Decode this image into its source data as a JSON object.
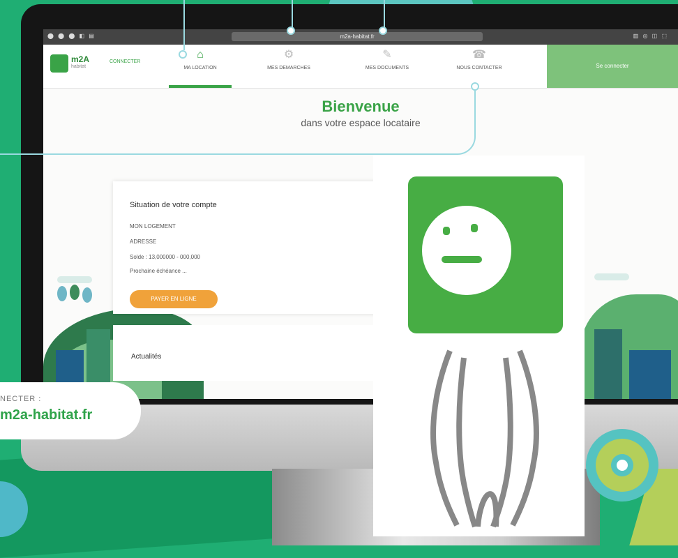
{
  "menubar": {
    "left": "⬤ ⬤ ⬤  ◧  ▤",
    "url": "m2a-habitat.fr",
    "right": "▥ ◎ ◫ ⬚"
  },
  "brand": {
    "name": "m2A",
    "sub": "habitat",
    "partner": "CONNECTER"
  },
  "nav": {
    "items": [
      {
        "label": "MA LOCATION",
        "icon": "home-icon"
      },
      {
        "label": "MES DEMARCHES",
        "icon": "gear-icon"
      },
      {
        "label": "MES DOCUMENTS",
        "icon": "document-icon"
      },
      {
        "label": "NOUS CONTACTER",
        "icon": "contact-icon"
      }
    ],
    "connect": "Se connecter"
  },
  "welcome": {
    "title": "Bienvenue",
    "subtitle": "dans votre espace locataire"
  },
  "account": {
    "title": "Situation de votre compte",
    "lines": [
      "MON LOGEMENT",
      "ADRESSE",
      "Solde : 13,000000 - 000,000",
      "Prochaine échéance ..."
    ],
    "button": "PAYER EN LIGNE"
  },
  "news": {
    "title": "Actualités"
  },
  "promo": {
    "line1": "NECTER :",
    "line2": "m2a-habitat.fr"
  },
  "colors": {
    "green": "#3aa347",
    "orange": "#f0a23a",
    "teal": "#5cc6c0",
    "bg": "#1fae73"
  }
}
